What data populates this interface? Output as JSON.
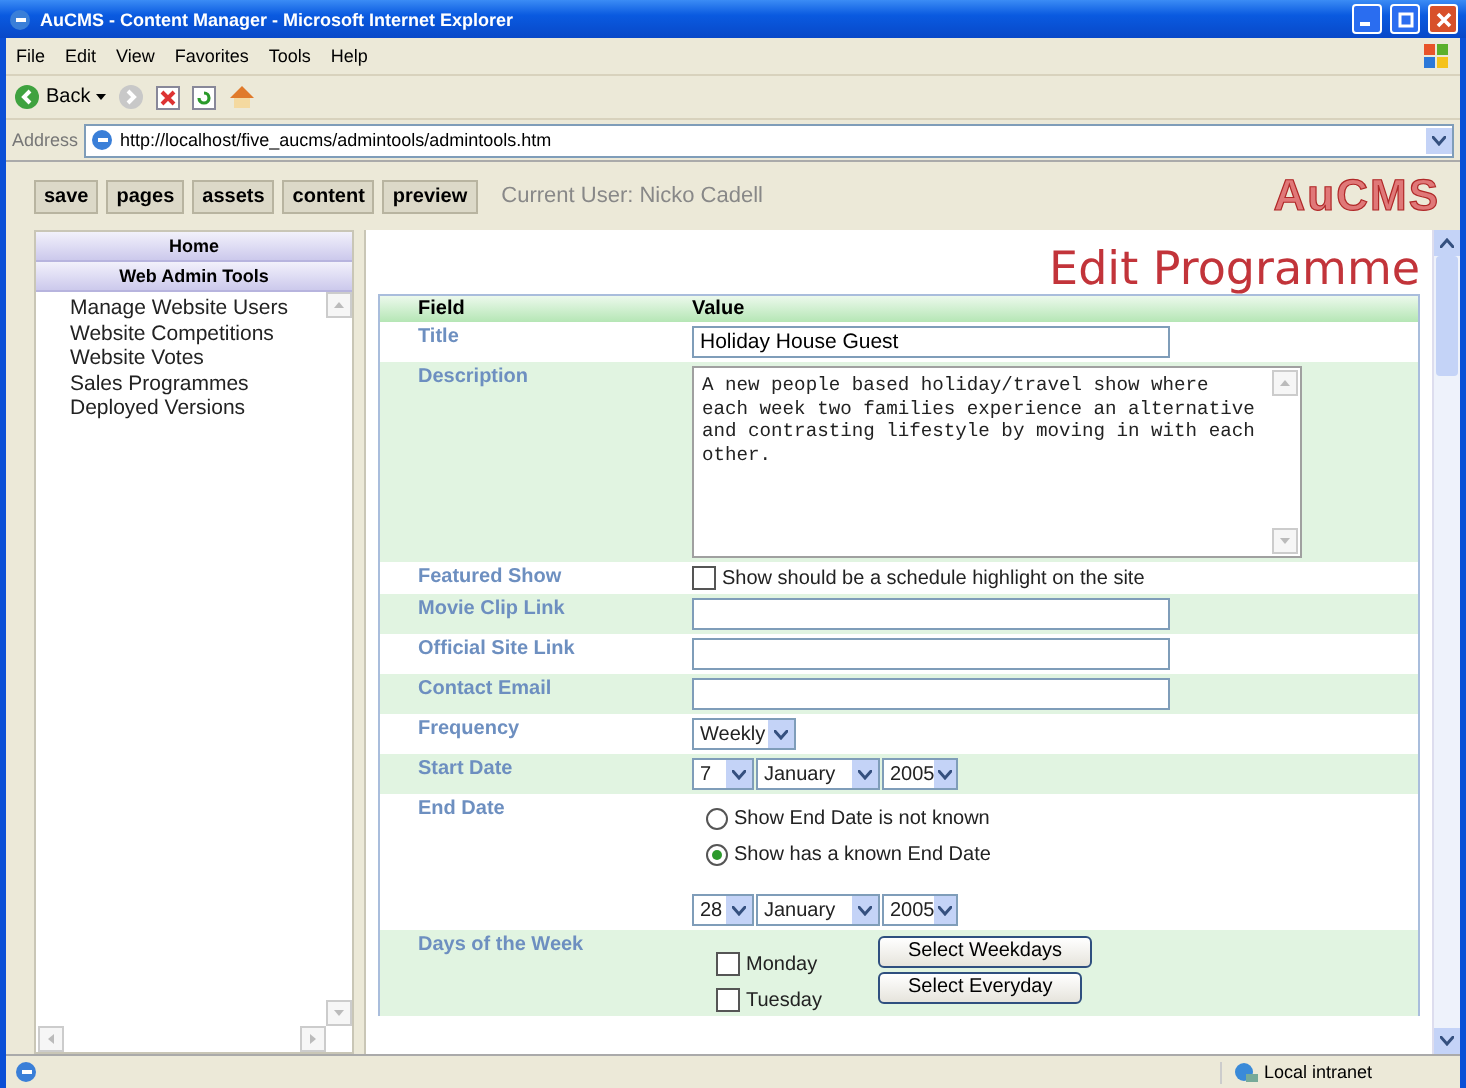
{
  "window": {
    "title": "AuCMS - Content Manager - Microsoft Internet Explorer"
  },
  "menu": [
    "File",
    "Edit",
    "View",
    "Favorites",
    "Tools",
    "Help"
  ],
  "browser_toolbar": {
    "back_label": "Back"
  },
  "address_bar": {
    "label": "Address",
    "url": "http://localhost/five_aucms/admintools/admintools.htm"
  },
  "app_toolbar": {
    "buttons": [
      "save",
      "pages",
      "assets",
      "content",
      "preview"
    ],
    "current_user": "Current User: Nicko Cadell",
    "logo": "AuCMS"
  },
  "sidebar": {
    "headers": [
      "Home",
      "Web Admin Tools"
    ],
    "items": [
      "Manage Website Users",
      "Website Competitions",
      "Website Votes",
      "Sales Programmes",
      "Deployed Versions"
    ]
  },
  "page_title": "Edit Programme",
  "table": {
    "columns": [
      "Field",
      "Value"
    ],
    "rows": [
      {
        "kind": "text",
        "label": "Title",
        "value": "Holiday House Guest"
      },
      {
        "kind": "textarea",
        "label": "Description",
        "value": "A new people based holiday/travel show where each week two families experience an alternative and contrasting lifestyle by moving in with each other."
      },
      {
        "kind": "checkbox",
        "label": "Featured Show",
        "checked": false,
        "text": "Show should be a schedule highlight on the site"
      },
      {
        "kind": "text",
        "label": "Movie Clip Link"
      },
      {
        "kind": "text",
        "label": "Official Site Link"
      },
      {
        "kind": "text",
        "label": "Contact Email"
      },
      {
        "kind": "select",
        "label": "Frequency",
        "value": "Weekly"
      },
      {
        "kind": "date",
        "label": "Start Date",
        "day": "7",
        "month": "January",
        "year": "2005"
      },
      {
        "kind": "end_date",
        "label": "End Date",
        "options": [
          {
            "label": "Show End Date is not known",
            "selected": false
          },
          {
            "label": "Show has a known End Date",
            "selected": true
          }
        ],
        "day": "28",
        "month": "January",
        "year": "2005"
      },
      {
        "kind": "days",
        "label": "Days of the Week",
        "days": [
          {
            "label": "Monday",
            "checked": false
          },
          {
            "label": "Tuesday",
            "checked": false
          }
        ],
        "buttons": [
          "Select Weekdays",
          "Select Everyday"
        ]
      }
    ]
  },
  "status_bar": {
    "zone": "Local intranet"
  }
}
